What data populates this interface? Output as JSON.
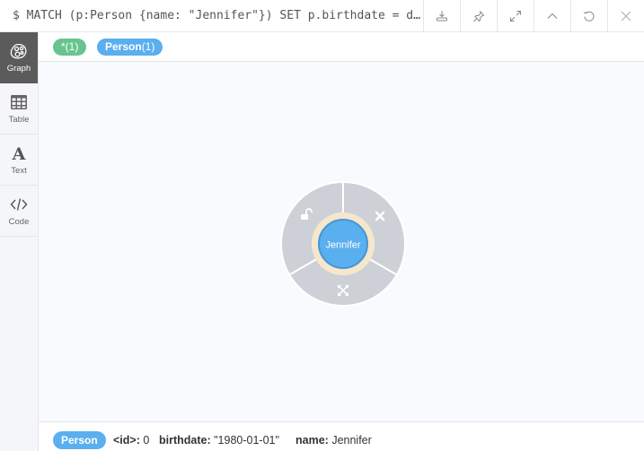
{
  "query": {
    "prompt": "$",
    "text": "MATCH (p:Person {name: \"Jennifer\"}) SET p.birthdate = d…"
  },
  "toolbar": {
    "buttons": [
      {
        "name": "download",
        "icon": "download-icon"
      },
      {
        "name": "pin",
        "icon": "pin-icon"
      },
      {
        "name": "fullscreen",
        "icon": "expand-icon"
      },
      {
        "name": "collapse",
        "icon": "chevron-up-icon"
      },
      {
        "name": "rerun",
        "icon": "refresh-icon"
      },
      {
        "name": "close",
        "icon": "close-icon"
      }
    ]
  },
  "sidebar": {
    "items": [
      {
        "label": "Graph",
        "icon": "graph-icon",
        "active": true
      },
      {
        "label": "Table",
        "icon": "table-icon",
        "active": false
      },
      {
        "label": "Text",
        "icon": "text-icon",
        "active": false
      },
      {
        "label": "Code",
        "icon": "code-icon",
        "active": false
      }
    ]
  },
  "tags": {
    "all": {
      "label": "*(1)",
      "color": "#68c48f"
    },
    "person": {
      "label_name": "Person",
      "label_count": "(1)",
      "color": "#5aafef"
    }
  },
  "graph": {
    "node": {
      "caption": "Jennifer",
      "color": "#5aafef",
      "border": "#4a94d4",
      "halo": "#f4e7cc"
    },
    "ring_color": "#cdd0d6",
    "ring_actions": [
      {
        "name": "unlock",
        "icon": "unlock-icon"
      },
      {
        "name": "remove",
        "icon": "close-icon"
      },
      {
        "name": "expand",
        "icon": "expand-arrows-icon"
      }
    ]
  },
  "footer": {
    "label": "Person",
    "properties": [
      {
        "key": "<id>:",
        "value": "0"
      },
      {
        "key": "birthdate:",
        "value": "\"1980-01-01\""
      },
      {
        "key": "name:",
        "value": "Jennifer"
      }
    ]
  }
}
